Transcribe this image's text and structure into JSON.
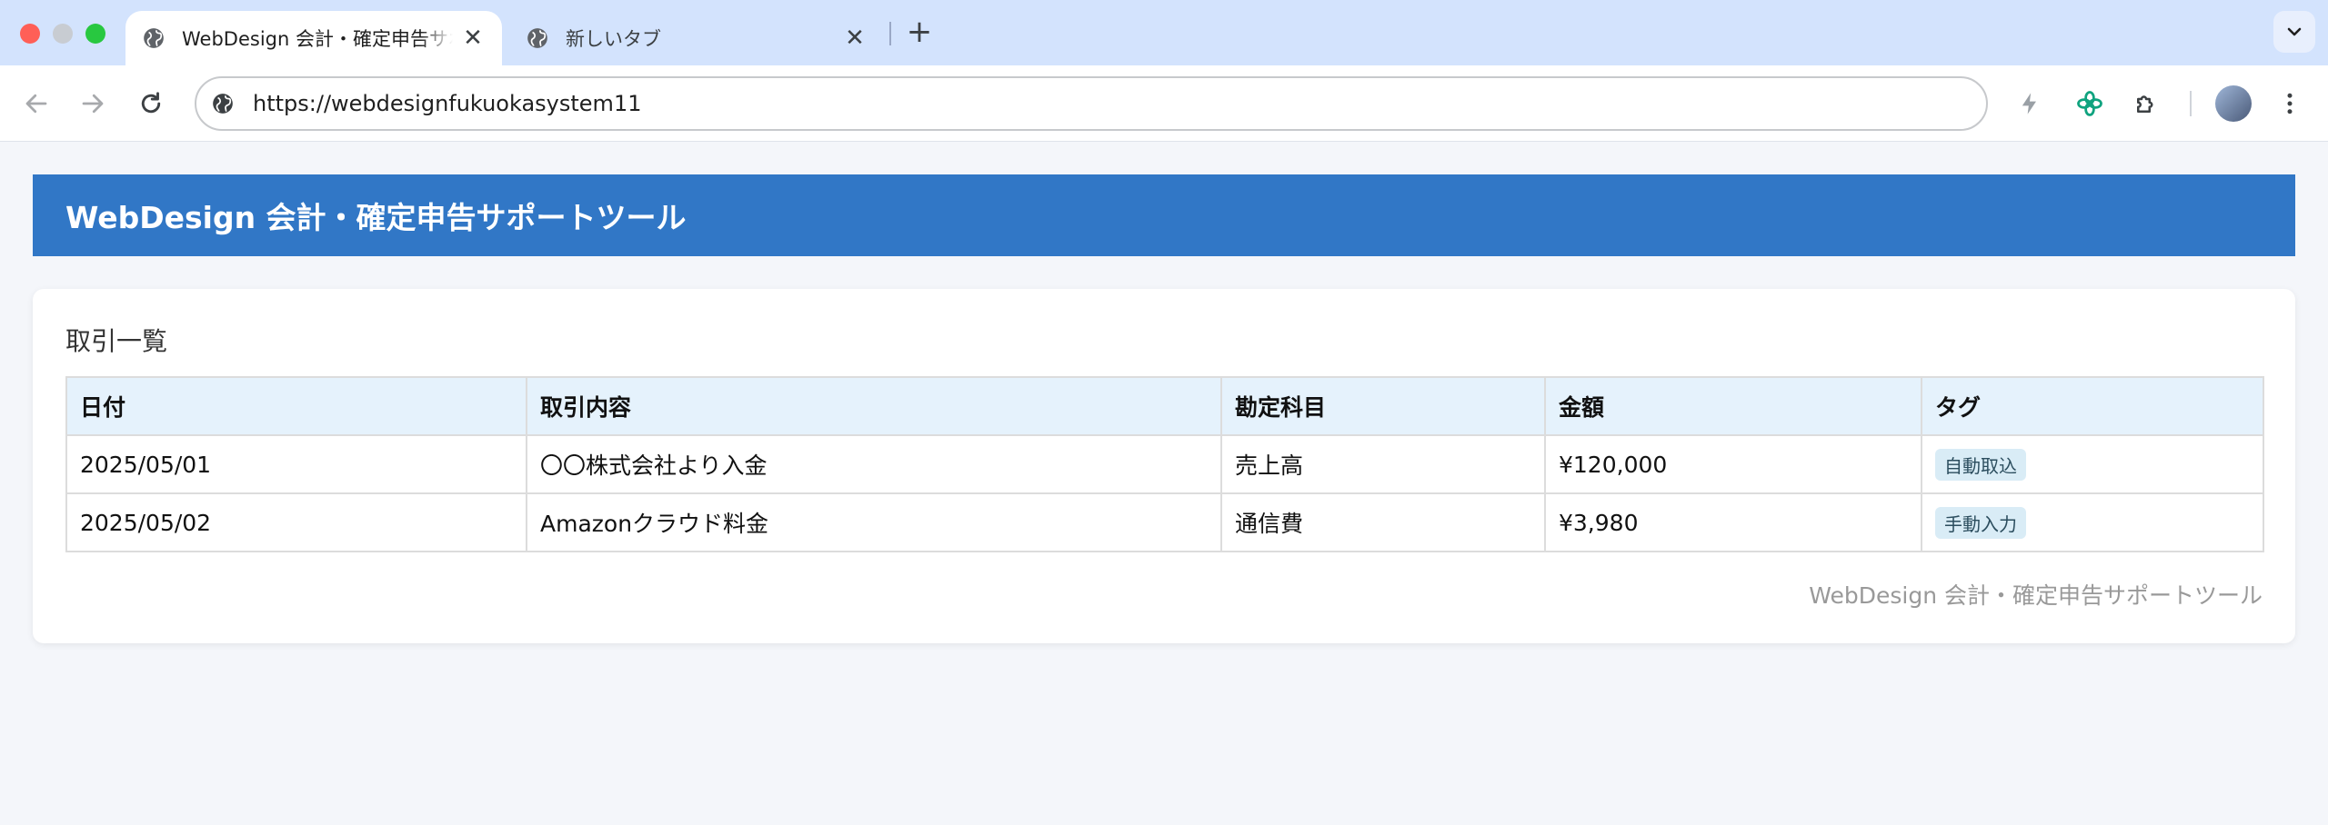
{
  "browser": {
    "tabs": [
      {
        "title": "WebDesign 会計・確定申告サポートツール",
        "active": true,
        "close_glyph": "✕"
      },
      {
        "title": "新しいタブ",
        "active": false,
        "close_glyph": "✕"
      }
    ],
    "new_tab_glyph": "+",
    "url": "https://webdesignfukuokasystem11"
  },
  "app": {
    "title": "WebDesign 会計・確定申告サポートツール",
    "section_title": "取引一覧",
    "table": {
      "headers": [
        "日付",
        "取引内容",
        "勘定科目",
        "金額",
        "タグ"
      ],
      "rows": [
        {
          "date": "2025/05/01",
          "description": "〇〇株式会社より入金",
          "account": "売上高",
          "amount": "¥120,000",
          "tag": "自動取込"
        },
        {
          "date": "2025/05/02",
          "description": "Amazonクラウド料金",
          "account": "通信費",
          "amount": "¥3,980",
          "tag": "手動入力"
        }
      ]
    },
    "footer": "WebDesign 会計・確定申告サポートツール"
  },
  "colors": {
    "header_bg": "#3177c6",
    "table_header_bg": "#e5f2fc",
    "tag_bg": "#d9ecf6"
  }
}
